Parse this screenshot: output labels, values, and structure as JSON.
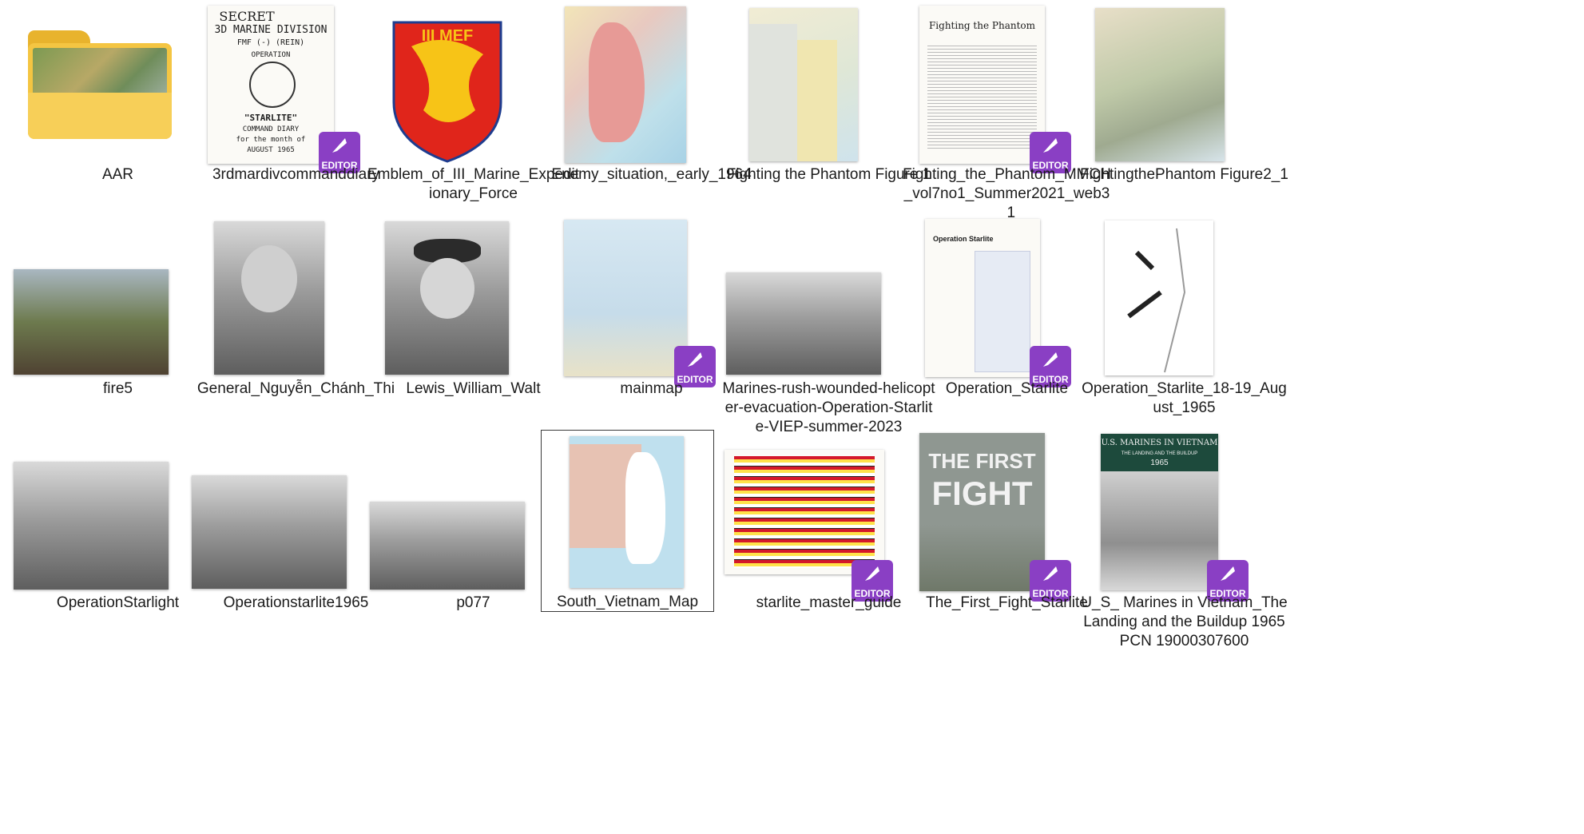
{
  "items": [
    {
      "name": "AAR"
    },
    {
      "name": "3rdmardivcommanddiary",
      "doc": {
        "line1": "SECRET",
        "line2": "3D MARINE DIVISION",
        "line3": "FMF (-) (REIN)",
        "line4": "OPERATION",
        "line5": "\"STARLITE\"",
        "line6": "COMMAND DIARY",
        "line7": "for the month of",
        "line8": "AUGUST 1965"
      }
    },
    {
      "name": "Emblem_of_III_Marine_Expeditionary_Force",
      "emblem": "III MEF"
    },
    {
      "name": "Enemy_situation,_early_1964"
    },
    {
      "name": "Fighting the Phantom Figure 1"
    },
    {
      "name": "Fighting_the_Phantom_MMCH_vol7no1_Summer2021_web3_1",
      "doc": {
        "title": "Fighting the Phantom"
      }
    },
    {
      "name": "FightingthePhantom Figure2_1"
    },
    {
      "name": "fire5"
    },
    {
      "name": "General_Nguyễn_Chánh_Thi"
    },
    {
      "name": "Lewis_William_Walt"
    },
    {
      "name": "mainmap"
    },
    {
      "name": "Marines-rush-wounded-helicopter-evacuation-Operation-Starlite-VIEP-summer-2023"
    },
    {
      "name": "Operation_Starlite",
      "doc": {
        "title": "Operation Starlite"
      }
    },
    {
      "name": "Operation_Starlite_18-19_August_1965"
    },
    {
      "name": "OperationStarlight"
    },
    {
      "name": "Operationstarlite1965"
    },
    {
      "name": "p077"
    },
    {
      "name": "South_Vietnam_Map"
    },
    {
      "name": "starlite_master_guide"
    },
    {
      "name": "The_First_Fight_Starlite",
      "cover": {
        "line1": "THE FIRST",
        "line2": "FIGHT"
      }
    },
    {
      "name": "U_S_ Marines in Vietnam_The Landing and the Buildup 1965  PCN 19000307600",
      "cover": {
        "line1": "U.S. MARINES IN VIETNAM",
        "line2": "THE LANDING AND THE BUILDUP",
        "line3": "1965"
      }
    }
  ],
  "badge_label": "EDITOR",
  "selected_index": 17,
  "colors": {
    "badge": "#8a3fc4",
    "folder": "#f4c542",
    "emblem_red": "#e0251b",
    "emblem_gold": "#f7c417"
  }
}
